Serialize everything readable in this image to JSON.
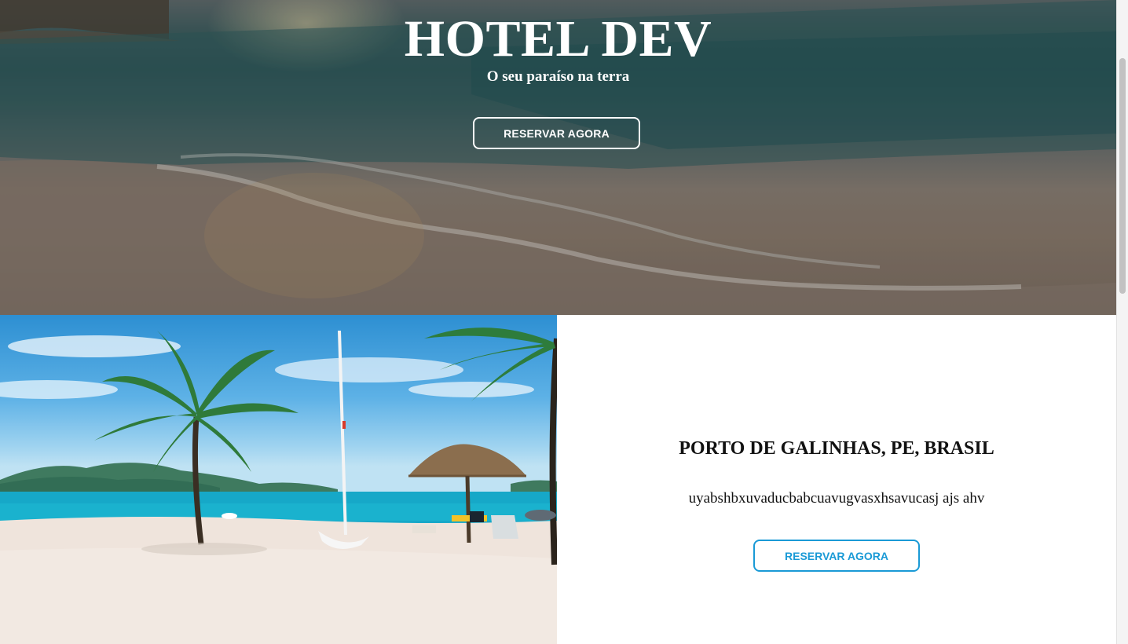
{
  "hero": {
    "title": "HOTEL DEV",
    "subtitle": "O seu paraíso na terra",
    "button_label": "RESERVAR AGORA"
  },
  "feature": {
    "title": "PORTO DE GALINHAS, PE, BRASIL",
    "description": "uyabshbxuvaducbabcuavugvasxhsavucasj ajs ahv",
    "button_label": "RESERVAR AGORA"
  },
  "colors": {
    "accent": "#1a9ad6",
    "hero_text": "#ffffff"
  }
}
